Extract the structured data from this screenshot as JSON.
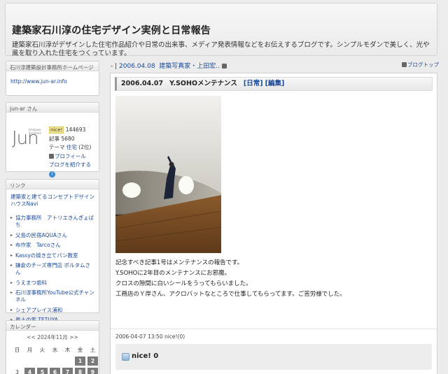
{
  "header": {
    "title": "建築家石川淳の住宅デザイン実例と日常報告",
    "description": "建築家石川淳がデザインした住宅作品紹介や日常の出来事、メディア発表情報などをお伝えするブログです。シンプルモダンで美しく、光や風を取り入れた住宅をつくっています。"
  },
  "sidebar": {
    "homepage": {
      "heading": "石川淳建築設計事務所ホームページ",
      "url": "http://www.jun-ar.info"
    },
    "profile": {
      "heading": "jun-ar さん",
      "logo_text": "Jun",
      "logo_small": "Ishikawa Architect",
      "nice_label": "nice!",
      "nice_count": "144693",
      "articles": "記事 5680",
      "theme_prefix": "テーマ ",
      "theme_link": "住宅",
      "theme_rank": " (2位)",
      "profile_link": "プロフィール",
      "introduce_link": "ブログを紹介する",
      "help_icon": "?"
    },
    "links": {
      "heading": "リンク",
      "first": "建築家と建てるコンセプトデザインハウスNavi",
      "items": [
        "協力事務所　アトリエきんぎょばち",
        "父島の民宿AQUAさん",
        "布作家　Tarcoさん",
        "Kassyの焼き立てパン教室",
        "鎌倉のチーズ専門店 ボルタムさん",
        "うえまつ歯科",
        "石川淳事務所YouTube公式チャンネル",
        "シェアプレイス浦和",
        "風土の家 TETUYA"
      ]
    },
    "calendar": {
      "heading": "カレンダー",
      "nav": "<< 2024年11月 >>",
      "weekdays": [
        "日",
        "月",
        "火",
        "水",
        "木",
        "金",
        "土"
      ],
      "row1": [
        "",
        "",
        "",
        "",
        "",
        "1",
        "2"
      ],
      "row2": [
        "3",
        "4",
        "5",
        "6",
        "7",
        "8",
        "9"
      ]
    }
  },
  "main": {
    "nav": {
      "prefix": "- | ",
      "date": "2006.04.08",
      "next_title": "建築写真家・上田宏..",
      "blogtop": "ブログトップ"
    },
    "entry": {
      "date": "2006.04.07",
      "title": "Y.SOHOメンテナンス",
      "category": "[日常]",
      "edit": "[編集]",
      "body": [
        "記念すべき記事1号はメンテナンスの報告です。",
        "Y.SOHOに2年目のメンテナンスにお邪魔。",
        "クロスの隙間に白いシールをうってもらいました。",
        "工務店のＹ岸さん、アクロバットなところで仕事してもらってます。ご苦労様でした。"
      ],
      "meta": "2006-04-07 13:50  nice!(0)",
      "nice_box": "nice! 0"
    }
  }
}
